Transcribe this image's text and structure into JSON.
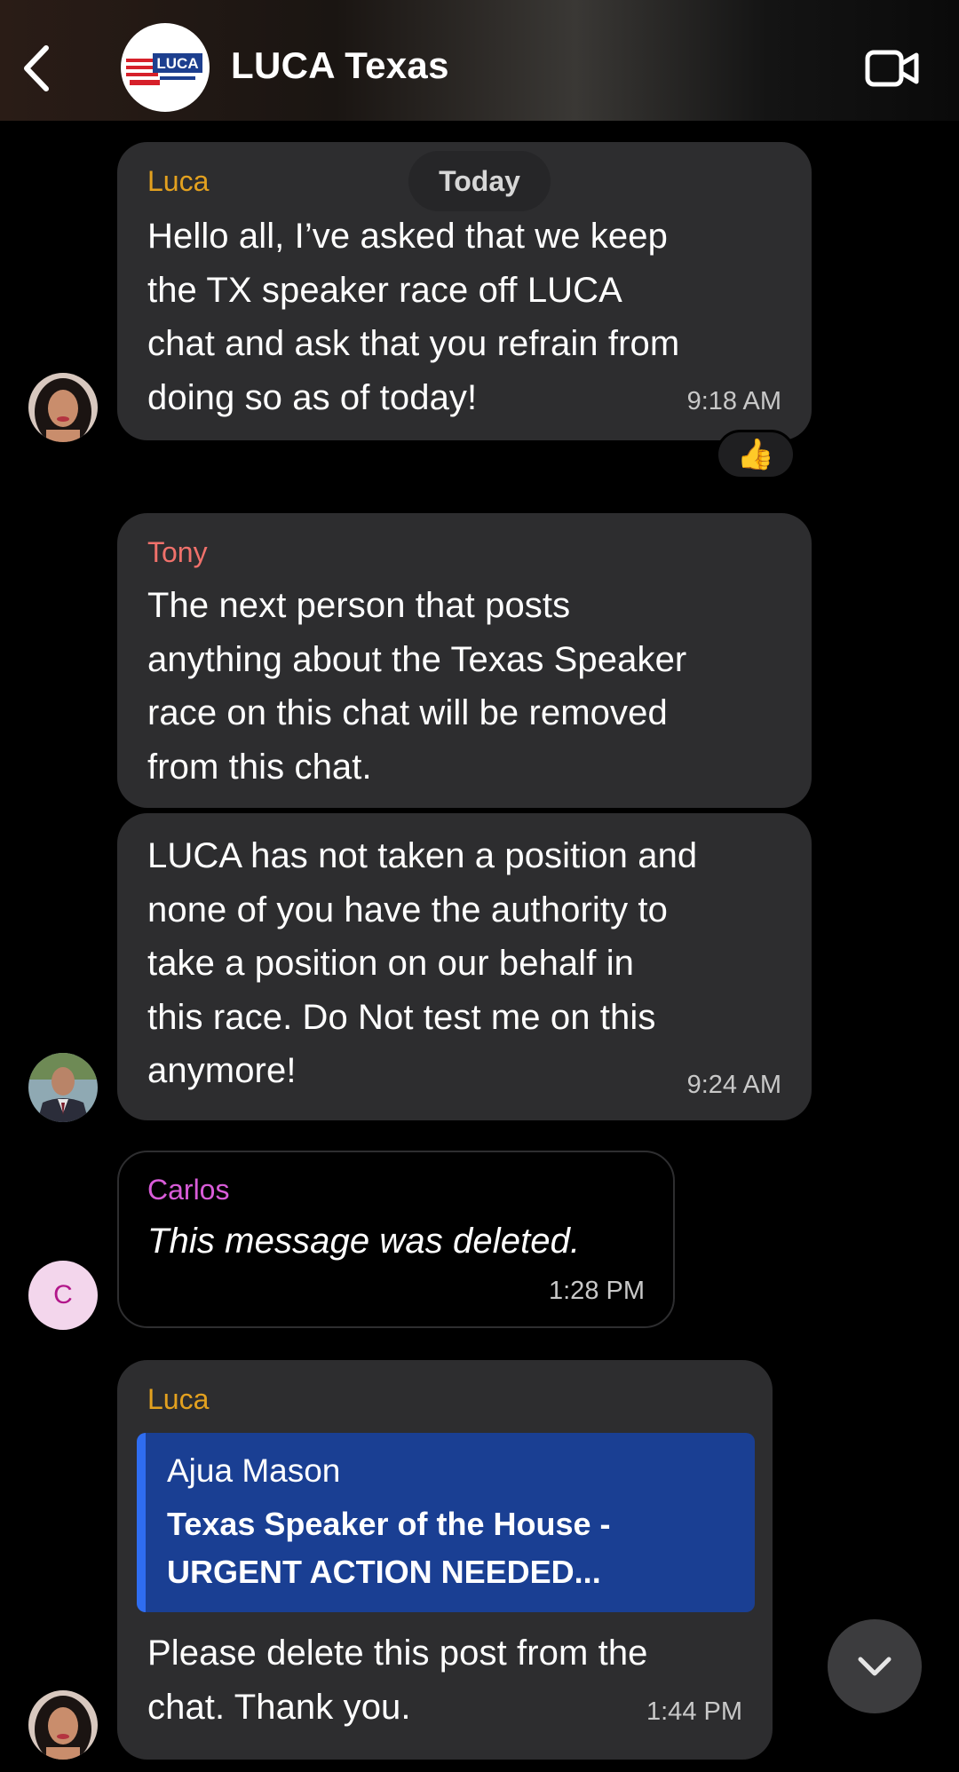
{
  "header": {
    "title": "LUCA Texas",
    "logo_text": "LUCA",
    "back_icon": "chevron-left-icon",
    "video_icon": "video-camera-icon"
  },
  "date_separator": "Today",
  "messages": [
    {
      "sender": "Luca",
      "sender_color": "#e3a11f",
      "text_lines": [
        "Hello all, I’ve asked that we keep",
        "the TX speaker race off LUCA",
        "chat and ask that you refrain from",
        "doing so as of today!"
      ],
      "time": "9:18 AM",
      "reaction": "👍"
    },
    {
      "sender": "Tony",
      "sender_color": "#f0716b",
      "text_lines": [
        "The next person that posts",
        "anything about the Texas Speaker",
        "race on this chat will be removed",
        "from this chat."
      ]
    },
    {
      "text_lines": [
        "LUCA has not taken a position and",
        "none of you have the authority to",
        "take a position on our behalf in",
        "this race. Do Not test me on this",
        "anymore!"
      ],
      "time": "9:24 AM"
    },
    {
      "sender": "Carlos",
      "sender_color": "#d95cd9",
      "text": "This message was deleted.",
      "time": "1:28 PM",
      "avatar_letter": "C"
    },
    {
      "sender": "Luca",
      "sender_color": "#e3a11f",
      "quote": {
        "author": "Ajua Mason",
        "lines": [
          "Texas Speaker of the House -",
          "URGENT ACTION NEEDED..."
        ]
      },
      "text_lines": [
        "Please delete this post from the",
        "chat. Thank you."
      ],
      "time": "1:44 PM"
    }
  ],
  "scroll_button_icon": "chevron-down-icon"
}
